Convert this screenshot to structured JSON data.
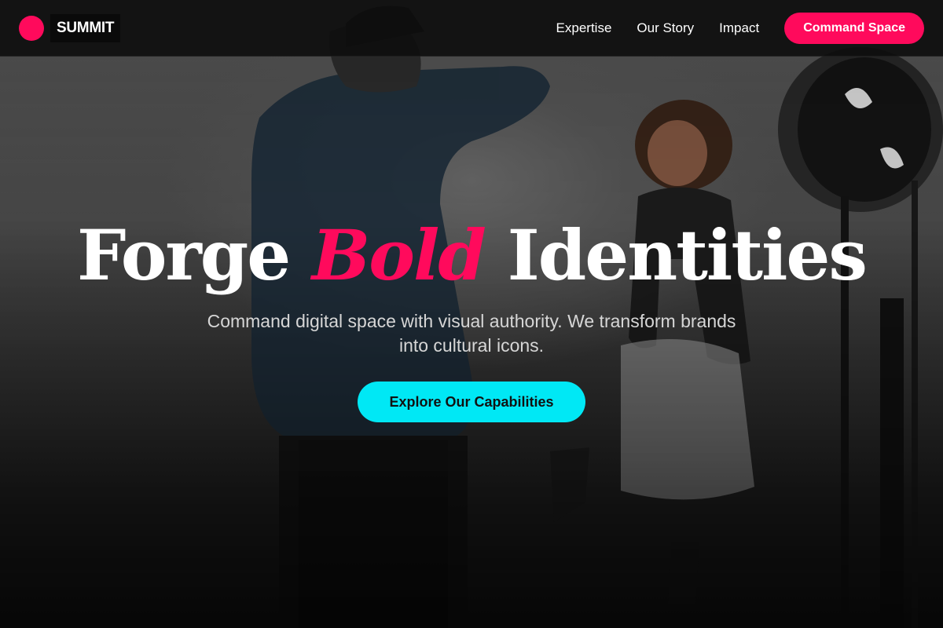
{
  "brand": {
    "name": "SUMMIT",
    "accent_color": "#ff0a5c",
    "cta_color": "#00e8f5"
  },
  "nav": {
    "links": [
      "Expertise",
      "Our Story",
      "Impact"
    ],
    "cta_label": "Command Space"
  },
  "hero": {
    "title_start": "Forge",
    "title_accent": "Bold",
    "title_end": "Identities",
    "subtitle": "Command digital space with visual authority. We transform brands into cultural icons.",
    "cta_label": "Explore Our Capabilities",
    "background": "photo-studio-scene-image"
  }
}
